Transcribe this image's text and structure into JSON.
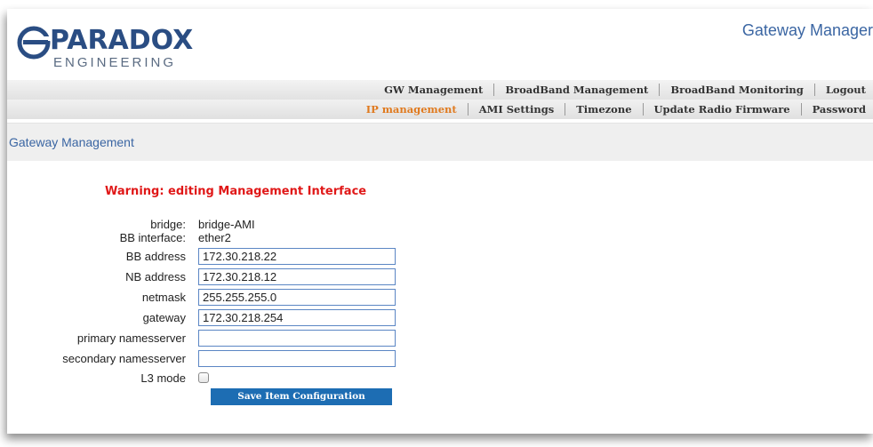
{
  "header": {
    "logo_main": "PARADOX",
    "logo_sub": "ENGINEERING",
    "app_title": "Gateway Manager"
  },
  "nav_primary": [
    {
      "label": "GW Management"
    },
    {
      "label": "BroadBand Management"
    },
    {
      "label": "BroadBand Monitoring"
    },
    {
      "label": "Logout"
    }
  ],
  "nav_secondary": [
    {
      "label": "IP management",
      "active": true
    },
    {
      "label": "AMI Settings"
    },
    {
      "label": "Timezone"
    },
    {
      "label": "Update Radio Firmware"
    },
    {
      "label": "Password"
    }
  ],
  "page": {
    "title": "Gateway Management",
    "warning": "Warning: editing Management Interface"
  },
  "form": {
    "bridge_label": "bridge:",
    "bridge_value": "bridge-AMI",
    "bb_interface_label": "BB interface:",
    "bb_interface_value": "ether2",
    "bb_address_label": "BB address",
    "bb_address_value": "172.30.218.22",
    "nb_address_label": "NB address",
    "nb_address_value": "172.30.218.12",
    "netmask_label": "netmask",
    "netmask_value": "255.255.255.0",
    "gateway_label": "gateway",
    "gateway_value": "172.30.218.254",
    "primary_ns_label": "primary namesserver",
    "primary_ns_value": "",
    "secondary_ns_label": "secondary namesserver",
    "secondary_ns_value": "",
    "l3_mode_label": "L3 mode",
    "l3_mode_checked": false,
    "save_label": "Save Item Configuration"
  },
  "colors": {
    "brand": "#2a4d83",
    "link": "#3b66a3",
    "active_menu": "#e07a1f",
    "warning": "#e01818",
    "button": "#1d6db3"
  }
}
